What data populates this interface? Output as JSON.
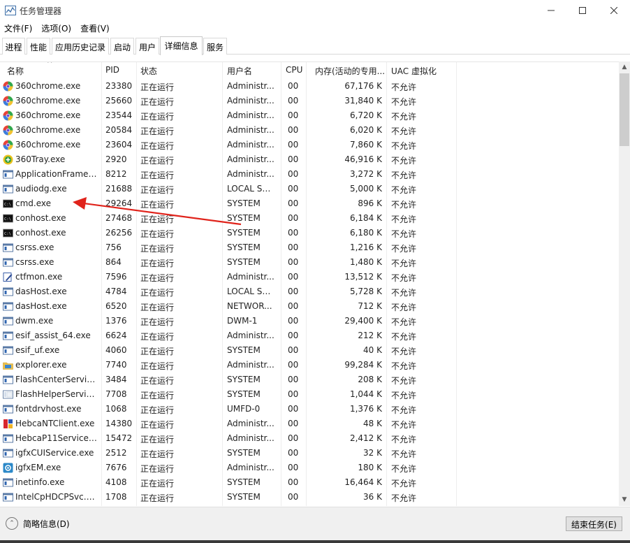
{
  "window": {
    "title": "任务管理器"
  },
  "menu": [
    "文件(F)",
    "选项(O)",
    "查看(V)"
  ],
  "tabs": [
    {
      "label": "进程",
      "active": false
    },
    {
      "label": "性能",
      "active": false
    },
    {
      "label": "应用历史记录",
      "active": false
    },
    {
      "label": "启动",
      "active": false
    },
    {
      "label": "用户",
      "active": false
    },
    {
      "label": "详细信息",
      "active": true
    },
    {
      "label": "服务",
      "active": false
    }
  ],
  "columns": [
    "名称",
    "PID",
    "状态",
    "用户名",
    "CPU",
    "内存(活动的专用...",
    "UAC 虚拟化"
  ],
  "rows": [
    {
      "icon": "360chrome-icon",
      "name": "360chrome.exe",
      "pid": "23380",
      "status": "正在运行",
      "user": "Administr...",
      "cpu": "00",
      "mem": "67,176 K",
      "uac": "不允许"
    },
    {
      "icon": "360chrome-icon",
      "name": "360chrome.exe",
      "pid": "25660",
      "status": "正在运行",
      "user": "Administr...",
      "cpu": "00",
      "mem": "31,840 K",
      "uac": "不允许"
    },
    {
      "icon": "360chrome-icon",
      "name": "360chrome.exe",
      "pid": "23544",
      "status": "正在运行",
      "user": "Administr...",
      "cpu": "00",
      "mem": "6,720 K",
      "uac": "不允许"
    },
    {
      "icon": "360chrome-icon",
      "name": "360chrome.exe",
      "pid": "20584",
      "status": "正在运行",
      "user": "Administr...",
      "cpu": "00",
      "mem": "6,020 K",
      "uac": "不允许"
    },
    {
      "icon": "360chrome-icon",
      "name": "360chrome.exe",
      "pid": "23604",
      "status": "正在运行",
      "user": "Administr...",
      "cpu": "00",
      "mem": "7,860 K",
      "uac": "不允许"
    },
    {
      "icon": "360tray-icon",
      "name": "360Tray.exe",
      "pid": "2920",
      "status": "正在运行",
      "user": "Administr...",
      "cpu": "00",
      "mem": "46,916 K",
      "uac": "不允许"
    },
    {
      "icon": "app-window-icon",
      "name": "ApplicationFrameH...",
      "pid": "8212",
      "status": "正在运行",
      "user": "Administr...",
      "cpu": "00",
      "mem": "3,272 K",
      "uac": "不允许"
    },
    {
      "icon": "app-window-icon",
      "name": "audiodg.exe",
      "pid": "21688",
      "status": "正在运行",
      "user": "LOCAL SE...",
      "cpu": "00",
      "mem": "5,000 K",
      "uac": "不允许"
    },
    {
      "icon": "console-icon",
      "name": "cmd.exe",
      "pid": "29264",
      "status": "正在运行",
      "user": "SYSTEM",
      "cpu": "00",
      "mem": "896 K",
      "uac": "不允许"
    },
    {
      "icon": "console-icon",
      "name": "conhost.exe",
      "pid": "27468",
      "status": "正在运行",
      "user": "SYSTEM",
      "cpu": "00",
      "mem": "6,184 K",
      "uac": "不允许"
    },
    {
      "icon": "console-icon",
      "name": "conhost.exe",
      "pid": "26256",
      "status": "正在运行",
      "user": "SYSTEM",
      "cpu": "00",
      "mem": "6,180 K",
      "uac": "不允许"
    },
    {
      "icon": "app-window-icon",
      "name": "csrss.exe",
      "pid": "756",
      "status": "正在运行",
      "user": "SYSTEM",
      "cpu": "00",
      "mem": "1,216 K",
      "uac": "不允许"
    },
    {
      "icon": "app-window-icon",
      "name": "csrss.exe",
      "pid": "864",
      "status": "正在运行",
      "user": "SYSTEM",
      "cpu": "00",
      "mem": "1,480 K",
      "uac": "不允许"
    },
    {
      "icon": "ctfmon-icon",
      "name": "ctfmon.exe",
      "pid": "7596",
      "status": "正在运行",
      "user": "Administr...",
      "cpu": "00",
      "mem": "13,512 K",
      "uac": "不允许"
    },
    {
      "icon": "app-window-icon",
      "name": "dasHost.exe",
      "pid": "4784",
      "status": "正在运行",
      "user": "LOCAL SE...",
      "cpu": "00",
      "mem": "5,728 K",
      "uac": "不允许"
    },
    {
      "icon": "app-window-icon",
      "name": "dasHost.exe",
      "pid": "6520",
      "status": "正在运行",
      "user": "NETWOR...",
      "cpu": "00",
      "mem": "712 K",
      "uac": "不允许"
    },
    {
      "icon": "app-window-icon",
      "name": "dwm.exe",
      "pid": "1376",
      "status": "正在运行",
      "user": "DWM-1",
      "cpu": "00",
      "mem": "29,400 K",
      "uac": "不允许"
    },
    {
      "icon": "app-window-icon",
      "name": "esif_assist_64.exe",
      "pid": "6624",
      "status": "正在运行",
      "user": "Administr...",
      "cpu": "00",
      "mem": "212 K",
      "uac": "不允许"
    },
    {
      "icon": "app-window-icon",
      "name": "esif_uf.exe",
      "pid": "4060",
      "status": "正在运行",
      "user": "SYSTEM",
      "cpu": "00",
      "mem": "40 K",
      "uac": "不允许"
    },
    {
      "icon": "explorer-icon",
      "name": "explorer.exe",
      "pid": "7740",
      "status": "正在运行",
      "user": "Administr...",
      "cpu": "00",
      "mem": "99,284 K",
      "uac": "不允许"
    },
    {
      "icon": "app-window-icon",
      "name": "FlashCenterService...",
      "pid": "3484",
      "status": "正在运行",
      "user": "SYSTEM",
      "cpu": "00",
      "mem": "208 K",
      "uac": "不允许"
    },
    {
      "icon": "flash-helper-icon",
      "name": "FlashHelperService...",
      "pid": "7708",
      "status": "正在运行",
      "user": "SYSTEM",
      "cpu": "00",
      "mem": "1,044 K",
      "uac": "不允许"
    },
    {
      "icon": "app-window-icon",
      "name": "fontdrvhost.exe",
      "pid": "1068",
      "status": "正在运行",
      "user": "UMFD-0",
      "cpu": "00",
      "mem": "1,376 K",
      "uac": "不允许"
    },
    {
      "icon": "hebca-icon",
      "name": "HebcaNTClient.exe",
      "pid": "14380",
      "status": "正在运行",
      "user": "Administr...",
      "cpu": "00",
      "mem": "48 K",
      "uac": "不允许"
    },
    {
      "icon": "app-window-icon",
      "name": "HebcaP11Service.e...",
      "pid": "15472",
      "status": "正在运行",
      "user": "Administr...",
      "cpu": "00",
      "mem": "2,412 K",
      "uac": "不允许"
    },
    {
      "icon": "app-window-icon",
      "name": "igfxCUIService.exe",
      "pid": "2512",
      "status": "正在运行",
      "user": "SYSTEM",
      "cpu": "00",
      "mem": "32 K",
      "uac": "不允许"
    },
    {
      "icon": "igfx-icon",
      "name": "igfxEM.exe",
      "pid": "7676",
      "status": "正在运行",
      "user": "Administr...",
      "cpu": "00",
      "mem": "180 K",
      "uac": "不允许"
    },
    {
      "icon": "app-window-icon",
      "name": "inetinfo.exe",
      "pid": "4108",
      "status": "正在运行",
      "user": "SYSTEM",
      "cpu": "00",
      "mem": "16,464 K",
      "uac": "不允许"
    },
    {
      "icon": "app-window-icon",
      "name": "IntelCpHDCPSvc.exe",
      "pid": "1708",
      "status": "正在运行",
      "user": "SYSTEM",
      "cpu": "00",
      "mem": "36 K",
      "uac": "不允许"
    }
  ],
  "footer": {
    "brief_label": "简略信息(D)",
    "end_task_label": "结束任务(E)"
  },
  "colors": {
    "annotation_arrow": "#e0231b"
  }
}
